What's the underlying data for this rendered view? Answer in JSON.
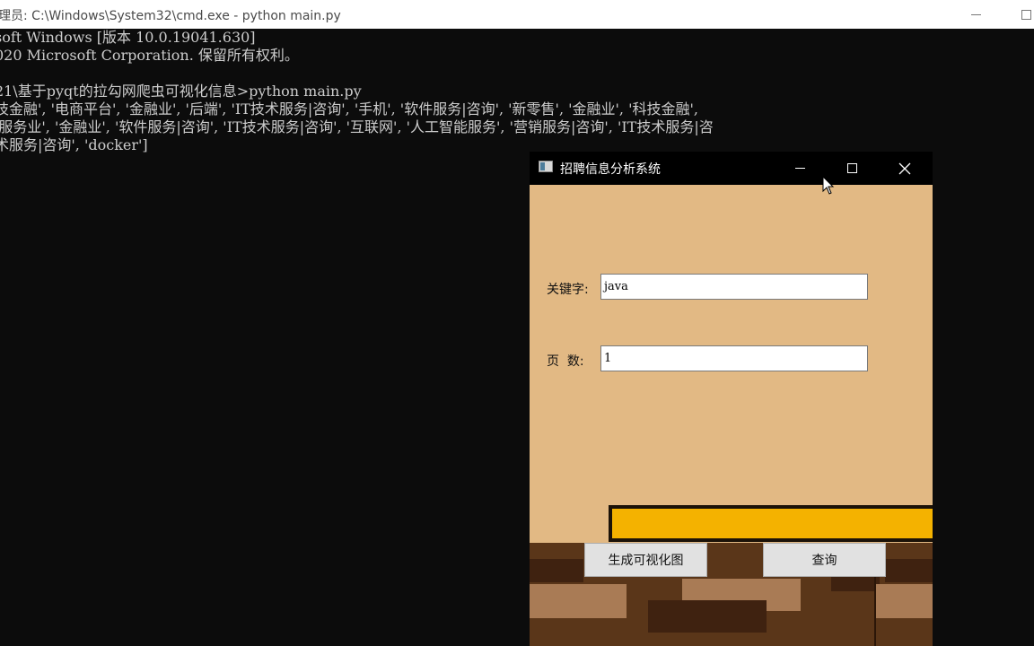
{
  "console_window": {
    "title": "理员: C:\\Windows\\System32\\cmd.exe - python  main.py"
  },
  "console_lines": [
    "soft Windows [版本 10.0.19041.630]",
    "020 Microsoft Corporation. 保留所有权利。",
    "",
    "21\\基于pyqt的拉勾网爬虫可视化信息>python main.py",
    "技金融', '电商平台', '金融业', '后端', 'IT技术服务|咨询', '手机', '软件服务|咨询', '新零售', '金融业', '科技金融',",
    "'服务业', '金融业', '软件服务|咨询', 'IT技术服务|咨询', '互联网', '人工智能服务', '营销服务|咨询', 'IT技术服务|咨",
    "术服务|咨询', 'docker']"
  ],
  "app_window": {
    "title": "招聘信息分析系统",
    "keyword_label": "关键字:",
    "keyword_value": "java",
    "pages_label": "页  数:",
    "pages_value": "1",
    "visualize_button": "生成可视化图",
    "query_button": "查询"
  },
  "colors": {
    "console_bg": "#0c0c0c",
    "console_fg": "#cccccc",
    "app_bg": "#e2b984",
    "gold": "#f4b200",
    "dirt": "#5a3619"
  },
  "icons": {
    "app_icon": "window-icon",
    "minimize": "minimize-icon",
    "maximize": "maximize-icon",
    "close": "close-icon"
  }
}
